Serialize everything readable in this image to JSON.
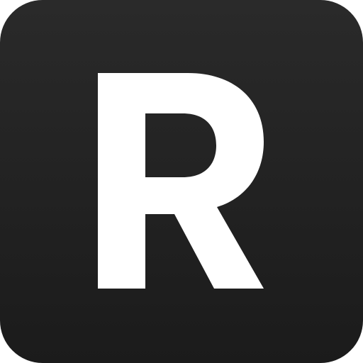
{
  "icon": {
    "letter": "R",
    "background_color_top": "#2a2a2a",
    "background_color_bottom": "#1b1b1b",
    "letter_color": "#ffffff"
  }
}
